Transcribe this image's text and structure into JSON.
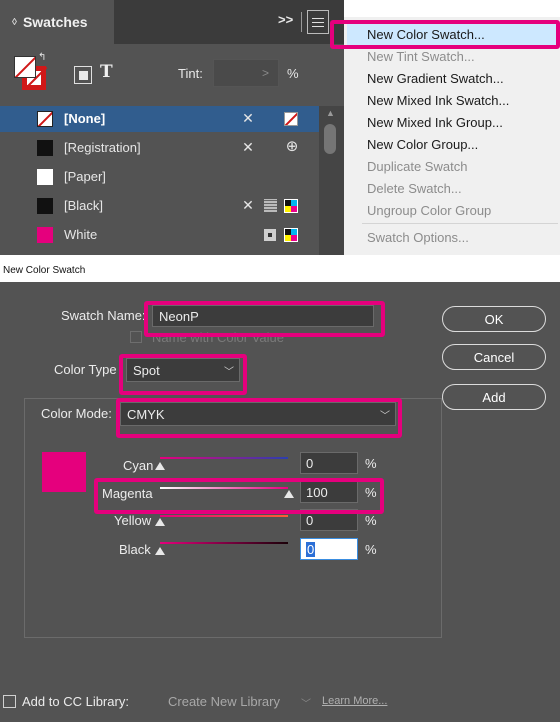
{
  "swatches_panel": {
    "title": "Swatches",
    "collapse_label": ">>",
    "tint_label": "Tint:",
    "tint_unit": "%",
    "items": [
      {
        "name": "[None]",
        "selected": true
      },
      {
        "name": "[Registration]",
        "selected": false
      },
      {
        "name": "[Paper]",
        "selected": false
      },
      {
        "name": "[Black]",
        "selected": false
      },
      {
        "name": "White",
        "selected": false
      }
    ]
  },
  "flyout_menu": {
    "items": [
      {
        "label": "New Color Swatch...",
        "enabled": true,
        "highlighted": true
      },
      {
        "label": "New Tint Swatch...",
        "enabled": false
      },
      {
        "label": "New Gradient Swatch...",
        "enabled": true
      },
      {
        "label": "New Mixed Ink Swatch...",
        "enabled": true
      },
      {
        "label": "New Mixed Ink Group...",
        "enabled": true
      },
      {
        "label": "New Color Group...",
        "enabled": true
      },
      {
        "label": "Duplicate Swatch",
        "enabled": false
      },
      {
        "label": "Delete Swatch...",
        "enabled": false
      },
      {
        "label": "Ungroup Color Group",
        "enabled": false
      },
      {
        "label": "Swatch Options...",
        "enabled": false
      }
    ]
  },
  "dialog": {
    "title": "New Color Swatch",
    "swatch_name_label": "Swatch Name:",
    "swatch_name_value": "NeonP",
    "name_with_value_label": "Name with Color Value",
    "color_type_label": "Color Type",
    "color_type_value": "Spot",
    "color_mode_label": "Color Mode:",
    "color_mode_value": "CMYK",
    "sliders": [
      {
        "label": "Cyan",
        "value": "0",
        "unit": "%"
      },
      {
        "label": "Magenta",
        "value": "100",
        "unit": "%"
      },
      {
        "label": "Yellow",
        "value": "0",
        "unit": "%"
      },
      {
        "label": "Black",
        "value": "0",
        "unit": "%"
      }
    ],
    "buttons": {
      "ok": "OK",
      "cancel": "Cancel",
      "add": "Add"
    },
    "cc_library_label": "Add to CC Library:",
    "cc_library_value": "Create New Library",
    "learn_more": "Learn More...",
    "preview_color": "#e5007d"
  },
  "colors": {
    "highlight_magenta": "#e5007d",
    "selection_blue": "#315d8e",
    "menu_highlight": "#cde8ff"
  }
}
